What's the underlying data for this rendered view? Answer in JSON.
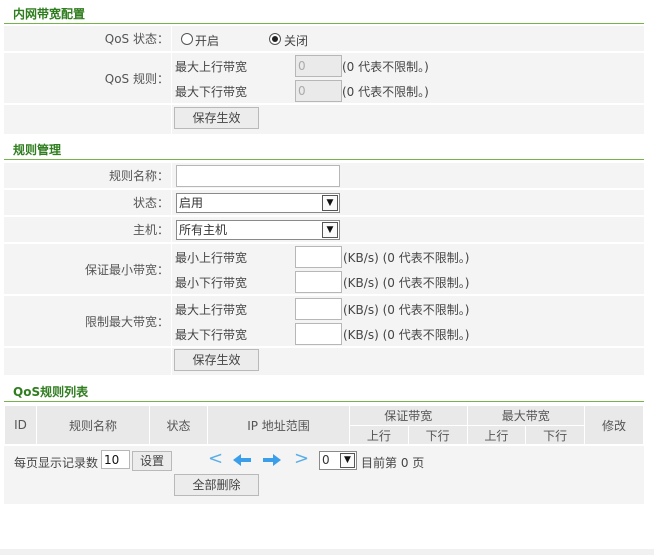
{
  "section1": {
    "title": "内网带宽配置",
    "qos_status_label": "QoS 状态：",
    "radio_on_label": "开启",
    "radio_off_label": "关闭",
    "qos_status_selected": "关闭",
    "qos_rule_label": "QoS 规则：",
    "max_up_label": "最大上行带宽",
    "max_up_value": "0",
    "max_down_label": "最大下行带宽",
    "max_down_value": "0",
    "unlimited_note": "(0 代表不限制。)",
    "save_label": "保存生效"
  },
  "section2": {
    "title": "规则管理",
    "rule_name_label": "规则名称：",
    "rule_name_value": "",
    "status_label": "状态：",
    "status_value": "启用",
    "host_label": "主机：",
    "host_value": "所有主机",
    "guarantee_label": "保证最小带宽：",
    "min_up_label": "最小上行带宽",
    "min_down_label": "最小下行带宽",
    "limit_label": "限制最大带宽：",
    "max_up_label": "最大上行带宽",
    "max_down_label": "最大下行带宽",
    "kb_note": "(KB/s) (0 代表不限制。)",
    "save_label": "保存生效"
  },
  "section3": {
    "title": "QoS规则列表",
    "columns": {
      "id": "ID",
      "name": "规则名称",
      "status": "状态",
      "ip_range": "IP 地址范围",
      "guarantee": "保证带宽",
      "max": "最大带宽",
      "edit": "修改",
      "up": "上行",
      "down": "下行"
    },
    "per_page_label": "每页显示记录数",
    "per_page_value": "10",
    "set_label": "设置",
    "page_select_value": "0",
    "current_page_text": "目前第 0 页",
    "delete_all_label": "全部删除"
  },
  "icons": {
    "first": "chevron-left-icon",
    "prev": "arrow-left-icon",
    "next": "arrow-right-icon",
    "last": "chevron-right-icon"
  },
  "colors": {
    "accent": "#2f7d1f",
    "divider": "#74b44a",
    "row_bg": "#f4f4f4",
    "nav_blue": "#5aaee8"
  }
}
